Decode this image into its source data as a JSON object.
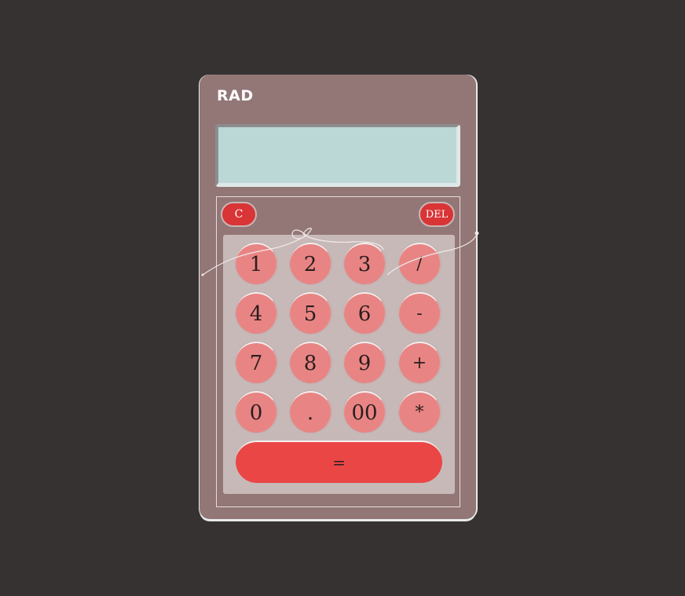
{
  "calculator": {
    "title": "RAD",
    "display_value": "",
    "clear_label": "C",
    "delete_label": "DEL",
    "equals_label": "="
  },
  "keys": [
    {
      "label": "1",
      "type": "digit"
    },
    {
      "label": "2",
      "type": "digit"
    },
    {
      "label": "3",
      "type": "digit"
    },
    {
      "label": "/",
      "type": "operator"
    },
    {
      "label": "4",
      "type": "digit"
    },
    {
      "label": "5",
      "type": "digit"
    },
    {
      "label": "6",
      "type": "digit"
    },
    {
      "label": "-",
      "type": "operator"
    },
    {
      "label": "7",
      "type": "digit"
    },
    {
      "label": "8",
      "type": "digit"
    },
    {
      "label": "9",
      "type": "digit"
    },
    {
      "label": "+",
      "type": "operator"
    },
    {
      "label": "0",
      "type": "digit"
    },
    {
      "label": ".",
      "type": "digit"
    },
    {
      "label": "00",
      "type": "digit"
    },
    {
      "label": "*",
      "type": "operator"
    }
  ],
  "colors": {
    "background": "#363232",
    "body": "#927776",
    "display": "#bcd8d6",
    "keypad": "#c8b9b9",
    "key": "#e88584",
    "action": "#d93436",
    "equals": "#ea4646"
  },
  "decoration_icon": "heart-doodle-icon"
}
